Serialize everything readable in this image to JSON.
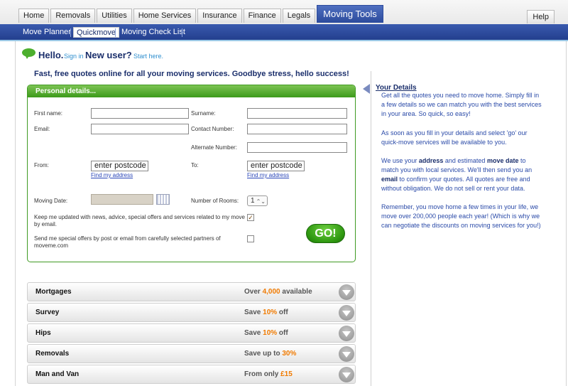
{
  "tabs": [
    "Home",
    "Removals",
    "Utilities",
    "Home Services",
    "Insurance",
    "Finance",
    "Legals",
    "Moving Tools"
  ],
  "help_label": "Help",
  "subnav": [
    "Move Planner",
    "Quickmove",
    "Moving Check List"
  ],
  "hello": {
    "hello": "Hello.",
    "signin": "Sign in",
    "new_user": "New user?",
    "start_here": "Start here."
  },
  "tagline": "Fast, free quotes online for all your moving services. Goodbye stress, hello success!",
  "form": {
    "heading": "Personal details...",
    "first_name_label": "First name:",
    "surname_label": "Surname:",
    "email_label": "Email:",
    "contact_label": "Contact Number:",
    "alternate_label": "Alternate Number:",
    "from_label": "From:",
    "to_label": "To:",
    "from_value": "enter postcode",
    "to_value": "enter postcode",
    "find_address": "Find my address",
    "moving_date_label": "Moving Date:",
    "rooms_label": "Number of Rooms:",
    "rooms_value": "1",
    "rooms_arrows": "⌃⌄",
    "check_updates": "Keep me updated with news, advice, special offers and services related to my move by email.",
    "check_updates_mark": "✓",
    "check_partners": "Send me special offers by post or email from carefully selected partners of moveme.com",
    "go_label": "GO!"
  },
  "info": {
    "title": "Your Details",
    "p1": "Get all the quotes you need to move home. Simply fill in a few details so we can match you with the best services in your area. So quick, so easy!",
    "p2": "As soon as you fill in your details and select 'go' our quick-move services will be available to you.",
    "p3_a": "We use your ",
    "p3_b": "address",
    "p3_c": " and estimated ",
    "p3_d": "move date",
    "p3_e": " to match you with local services. We'll then send you an ",
    "p3_f": "email",
    "p3_g": " to confirm your quotes. All quotes are free and without obligation. We do not sell or rent your data.",
    "p4": "Remember, you move home a few times in your life, we move over 200,000 people each year! (Which is why we can negotiate the discounts on moving services for you!)"
  },
  "services": [
    {
      "name": "Mortgages",
      "pre": "Over ",
      "hl": "4,000",
      "post": " available"
    },
    {
      "name": "Survey",
      "pre": "Save ",
      "hl": "10%",
      "post": " off"
    },
    {
      "name": "Hips",
      "pre": "Save ",
      "hl": "10%",
      "post": " off"
    },
    {
      "name": "Removals",
      "pre": "Save up to ",
      "hl": "30%",
      "post": ""
    },
    {
      "name": "Man and Van",
      "pre": "From only ",
      "hl": "£15",
      "post": ""
    }
  ],
  "colors": {
    "nav_blue": "#2c4b9c",
    "green": "#3c9a1a",
    "orange": "#f07a00",
    "link_blue": "#2a46b8"
  }
}
